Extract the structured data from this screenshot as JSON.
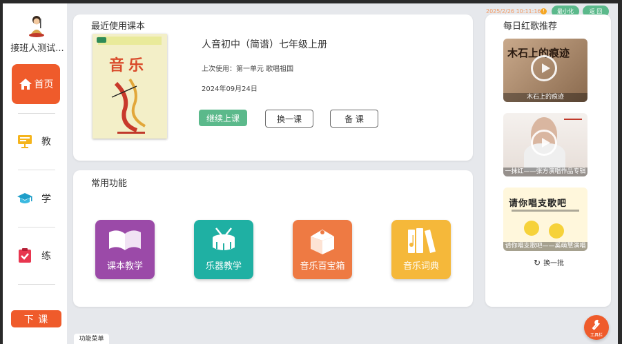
{
  "topbar": {
    "datetime": "2025/2/26 10:11:16",
    "minimize_label": "最小化",
    "back_label": "返 回"
  },
  "sidebar": {
    "username": "接班人测试...",
    "nav": [
      {
        "label": "首页",
        "icon": "home-icon",
        "active": true
      },
      {
        "label": "教",
        "icon": "teaching-board-icon"
      },
      {
        "label": "学",
        "icon": "graduation-cap-icon"
      },
      {
        "label": "练",
        "icon": "clipboard-check-icon"
      }
    ],
    "end_class_label": "下 课"
  },
  "recent": {
    "title": "最近使用课本",
    "cover_title": "音乐",
    "book_title": "人音初中（简谱）七年级上册",
    "last_used": "上次使用：第一单元 歌唱祖国",
    "date": "2024年09月24日",
    "continue_label": "继续上课",
    "change_label": "换一课",
    "prepare_label": "备 课"
  },
  "functions": {
    "title": "常用功能",
    "items": [
      {
        "label": "课本教学",
        "icon": "open-book-icon",
        "color": "#9b4aa8"
      },
      {
        "label": "乐器教学",
        "icon": "drum-icon",
        "color": "#1fb0a3"
      },
      {
        "label": "音乐百宝箱",
        "icon": "treasure-box-icon",
        "color": "#ee7a43"
      },
      {
        "label": "音乐词典",
        "icon": "books-icon",
        "color": "#f5b83a"
      }
    ]
  },
  "daily": {
    "title": "每日红歌推荐",
    "items": [
      {
        "thumb_text": "木石上的痕迹",
        "caption": "木石上的痕迹"
      },
      {
        "thumb_text": "",
        "caption": "一抹红——张方演唱作品专辑"
      },
      {
        "thumb_text": "请你唱支歌吧",
        "caption": "请你唱支歌吧——奚萌慧演唱"
      }
    ],
    "refresh_label": "换一批"
  },
  "footer": {
    "menu_label": "功能菜单",
    "tools_label": "工具栏"
  }
}
